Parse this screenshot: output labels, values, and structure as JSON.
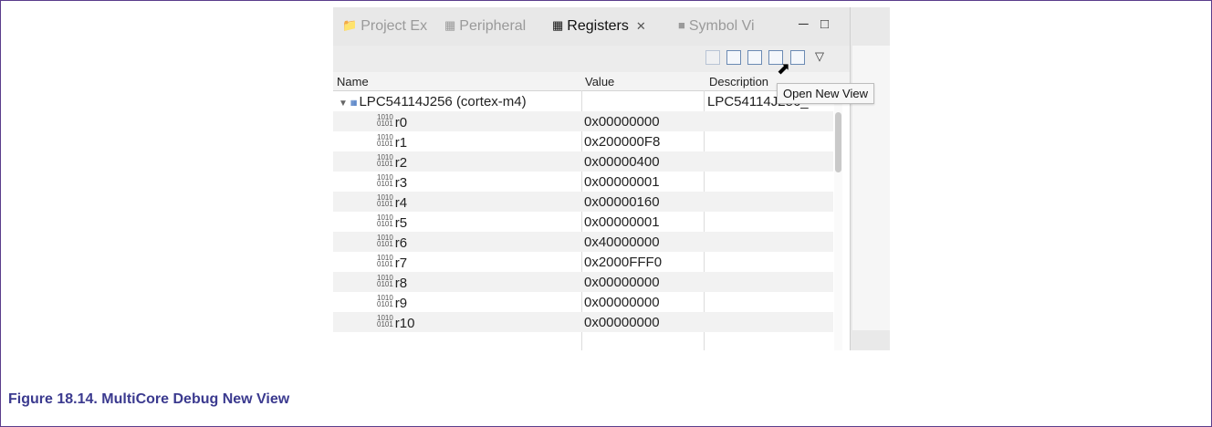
{
  "tabs": [
    {
      "label": "Project Ex",
      "icon": "project-explorer-icon"
    },
    {
      "label": "Peripheral",
      "icon": "peripheral-icon"
    },
    {
      "label": "Registers",
      "icon": "registers-icon",
      "active": true
    },
    {
      "label": "Symbol Vi",
      "icon": "symbol-viewer-icon"
    }
  ],
  "table": {
    "columns": [
      "Name",
      "Value",
      "Description"
    ],
    "group": {
      "name": "LPC54114J256 (cortex-m4)",
      "description": "LPC54114J256_"
    },
    "rows": [
      {
        "name": "r0",
        "value": "0x00000000"
      },
      {
        "name": "r1",
        "value": "0x200000F8"
      },
      {
        "name": "r2",
        "value": "0x00000400"
      },
      {
        "name": "r3",
        "value": "0x00000001"
      },
      {
        "name": "r4",
        "value": "0x00000160"
      },
      {
        "name": "r5",
        "value": "0x00000001"
      },
      {
        "name": "r6",
        "value": "0x40000000"
      },
      {
        "name": "r7",
        "value": "0x2000FFF0"
      },
      {
        "name": "r8",
        "value": "0x00000000"
      },
      {
        "name": "r9",
        "value": "0x00000000"
      },
      {
        "name": "r10",
        "value": "0x00000000"
      }
    ]
  },
  "tooltip": "Open New View",
  "caption": "Figure 18.14. MultiCore Debug New View"
}
